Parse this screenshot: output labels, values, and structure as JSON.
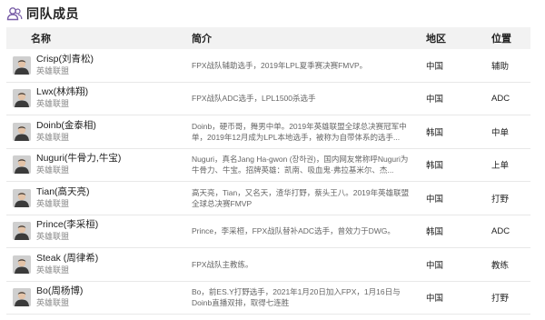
{
  "section": {
    "title": "同队成员",
    "icon": "users-icon"
  },
  "table": {
    "headers": {
      "name": "名称",
      "desc": "简介",
      "region": "地区",
      "pos": "位置"
    },
    "rows": [
      {
        "name": "Crisp(刘青松)",
        "team": "英雄联盟",
        "desc": "FPX战队辅助选手，2019年LPL夏季赛决赛FMVP。",
        "region": "中国",
        "pos": "辅助"
      },
      {
        "name": "Lwx(林炜翔)",
        "team": "英雄联盟",
        "desc": "FPX战队ADC选手，LPL1500杀选手",
        "region": "中国",
        "pos": "ADC"
      },
      {
        "name": "Doinb(金泰相)",
        "team": "英雄联盟",
        "desc": "Doinb，硬币哥，舞男中单。2019年英雄联盟全球总决赛冠军中单，2019年12月成为LPL本地选手，被称为自带体系的选手...",
        "region": "韩国",
        "pos": "中单"
      },
      {
        "name": "Nuguri(牛骨力,牛宝)",
        "team": "英雄联盟",
        "desc": "Nuguri，真名Jang Ha-gwon (장하권)，国内网友常称呼Nuguri为牛骨力、牛宝。招牌英雄：凯南、吸血鬼·弗拉基米尔、杰...",
        "region": "韩国",
        "pos": "上单"
      },
      {
        "name": "Tian(高天亮)",
        "team": "英雄联盟",
        "desc": "高天亮，Tian，又名天，渣华打野，蔡头王八。2019年英雄联盟全球总决赛FMVP",
        "region": "中国",
        "pos": "打野"
      },
      {
        "name": "Prince(李采桓)",
        "team": "英雄联盟",
        "desc": "Prince，李采桓，FPX战队替补ADC选手，曾效力于DWG。",
        "region": "韩国",
        "pos": "ADC"
      },
      {
        "name": "Steak (周律希)",
        "team": "英雄联盟",
        "desc": "FPX战队主教练。",
        "region": "中国",
        "pos": "教练"
      },
      {
        "name": "Bo(周杨博)",
        "team": "英雄联盟",
        "desc": "Bo，前ES.Y打野选手，2021年1月20日加入FPX，1月16日与Doinb直播双排，取得七连胜",
        "region": "中国",
        "pos": "打野"
      }
    ]
  }
}
